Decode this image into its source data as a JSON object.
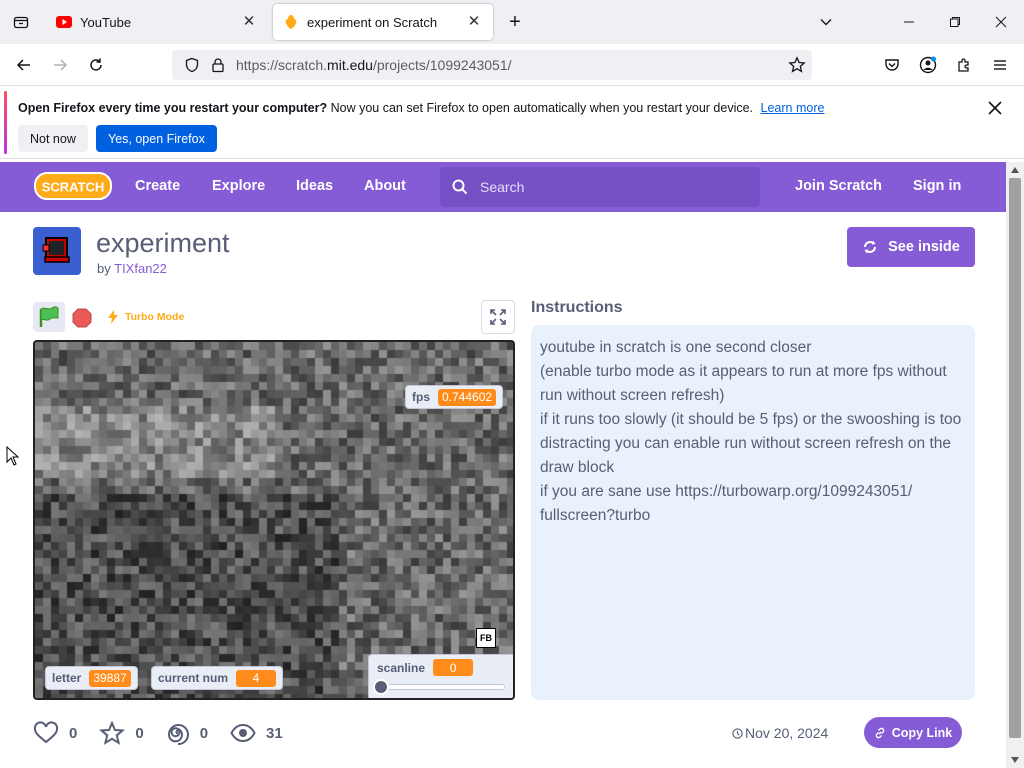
{
  "browser": {
    "tabs": [
      {
        "title": "YouTube",
        "active": false
      },
      {
        "title": "experiment on Scratch",
        "active": true
      }
    ],
    "url_prefix": "https://scratch.",
    "url_domain": "mit.edu",
    "url_path": "/projects/1099243051/",
    "new_tab_label": "+",
    "close_glyph": "✕"
  },
  "notification": {
    "bold_text": "Open Firefox every time you restart your computer?",
    "text": " Now you can set Firefox to open automatically when you restart your device.",
    "learn_more": "Learn more",
    "not_now": "Not now",
    "yes_open": "Yes, open Firefox"
  },
  "scratch_nav": {
    "logo": "SCRATCH",
    "items": [
      "Create",
      "Explore",
      "Ideas",
      "About"
    ],
    "search_placeholder": "Search",
    "join": "Join Scratch",
    "sign_in": "Sign in",
    "brand_color": "#855cd6"
  },
  "project": {
    "title": "experiment",
    "by": "by",
    "author": "TIXfan22",
    "see_inside": "See inside",
    "turbo_label": "Turbo Mode"
  },
  "monitors": {
    "fps_label": "fps",
    "fps_value": "0.744602",
    "letter_label": "letter",
    "letter_value": "39887",
    "current_num_label": "current num",
    "current_num_value": "4",
    "scanline_label": "scanline",
    "scanline_value": "0",
    "fb_label": "FB"
  },
  "instructions": {
    "title": "Instructions",
    "lines": [
      "youtube in scratch is one second closer",
      "(enable turbo mode as it appears to run at more fps without run without screen refresh)",
      "if it runs too slowly (it should be 5 fps) or the swooshing is too distracting you can enable run without screen refresh on the draw block",
      "if you are sane use https://turbowarp.org/1099243051/ fullscreen?turbo"
    ]
  },
  "stats": {
    "loves": "0",
    "favorites": "0",
    "remixes": "0",
    "views": "31",
    "date": "Nov 20, 2024",
    "copy_link": "Copy Link"
  }
}
